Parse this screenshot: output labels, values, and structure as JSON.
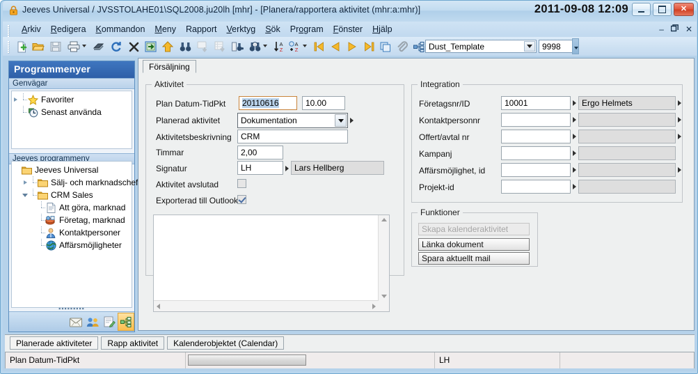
{
  "window": {
    "title": "Jeeves Universal / JVSSTOLAHE01\\SQL2008.ju20lh [mhr]  - [Planera/rapportera aktivitet (mhr:a:mhr)]",
    "clock": "2011-09-08 12:09",
    "lock_icon": "lock-icon",
    "minimize_label": "–",
    "maximize_label": "▭",
    "close_label": "✕",
    "mdi_minimize": "–",
    "mdi_restore": "❐",
    "mdi_close": "✕"
  },
  "menu": {
    "items": [
      {
        "label": "Arkiv",
        "accel": "A"
      },
      {
        "label": "Redigera",
        "accel": "R"
      },
      {
        "label": "Kommandon",
        "accel": "K"
      },
      {
        "label": "Meny",
        "accel": "M"
      },
      {
        "label": "Rapport",
        "accel": ""
      },
      {
        "label": "Verktyg",
        "accel": "V"
      },
      {
        "label": "Sök",
        "accel": "S"
      },
      {
        "label": "Program",
        "accel": "o"
      },
      {
        "label": "Fönster",
        "accel": "F"
      },
      {
        "label": "Hjälp",
        "accel": "H"
      }
    ]
  },
  "toolbar": {
    "template_value": "Dust_Template",
    "number_value": "9998",
    "icons": [
      "new-document-icon",
      "open-folder-icon",
      "save-disk-icon",
      "print-icon",
      "print-dropdown-arrow",
      "erase-icon",
      "refresh-icon",
      "delete-x-icon",
      "open-window-icon",
      "up-arrow-icon",
      "find-binoculars-icon",
      "note-down-icon",
      "grid-down-icon",
      "find-record-icon",
      "find-info-icon",
      "find-dropdown-arrow",
      "sort-az-icon",
      "sort-az-plus-icon",
      "sort-dropdown-arrow",
      "first-record-icon",
      "prev-record-icon",
      "next-record-icon",
      "last-record-icon",
      "copy-icon",
      "attach-clip-icon",
      "hierarchy-icon"
    ]
  },
  "sidebar": {
    "title": "Programmenyer",
    "sections": [
      {
        "header": "Genvägar"
      },
      {
        "header": "Jeeves programmeny"
      }
    ],
    "shortcuts": [
      {
        "label": "Favoriter",
        "icon": "star-icon",
        "expander": "collapsed"
      },
      {
        "label": "Senast använda",
        "icon": "clock-icon",
        "expander": "none"
      }
    ],
    "tree": [
      {
        "label": "Jeeves Universal",
        "icon": "folder-icon",
        "depth": 0,
        "expander": "none"
      },
      {
        "label": "Sälj- och marknadschef",
        "icon": "folder-icon",
        "depth": 1,
        "expander": "collapsed"
      },
      {
        "label": "CRM Sales",
        "icon": "folder-icon",
        "depth": 1,
        "expander": "expanded"
      },
      {
        "label": "Att göra, marknad",
        "icon": "document-icon",
        "depth": 2,
        "expander": "none"
      },
      {
        "label": "Företag, marknad",
        "icon": "company-icon",
        "depth": 2,
        "expander": "none"
      },
      {
        "label": "Kontaktpersoner",
        "icon": "person-icon",
        "depth": 2,
        "expander": "none"
      },
      {
        "label": "Affärsmöjligheter",
        "icon": "globe-icon",
        "depth": 2,
        "expander": "none"
      }
    ],
    "iconbar": [
      "mail-icon",
      "contacts-icon",
      "edit-note-icon",
      "hierarchy-icon"
    ]
  },
  "form": {
    "tab_label": "Försäljning",
    "aktivitet": {
      "title": "Aktivitet",
      "fields": {
        "plan_datum_label": "Plan Datum-TidPkt",
        "plan_datum_value": "20110616",
        "plan_tid_value": "10.00",
        "planerad_aktivitet_label": "Planerad aktivitet",
        "planerad_aktivitet_value": "Dokumentation",
        "aktivitetsbeskrivning_label": "Aktivitetsbeskrivning",
        "aktivitetsbeskrivning_value": "CRM",
        "timmar_label": "Timmar",
        "timmar_value": "2,00",
        "signatur_label": "Signatur",
        "signatur_value": "LH",
        "signatur_name": "Lars Hellberg",
        "avslutad_label": "Aktivitet avslutad",
        "avslutad_checked": false,
        "outlook_label": "Exporterad till Outlook",
        "outlook_checked": true
      },
      "memo_value": ""
    },
    "integration": {
      "title": "Integration",
      "rows": [
        {
          "label": "Företagsnr/ID",
          "value": "10001",
          "desc": "Ergo Helmets",
          "has_desc_arrow": true
        },
        {
          "label": "Kontaktpersonnr",
          "value": "",
          "desc": "",
          "has_desc_arrow": true
        },
        {
          "label": "Offert/avtal nr",
          "value": "",
          "desc": "",
          "has_desc_arrow": true
        },
        {
          "label": "Kampanj",
          "value": "",
          "desc": "",
          "has_desc_arrow": false
        },
        {
          "label": "Affärsmöjlighet, id",
          "value": "",
          "desc": "",
          "has_desc_arrow": true
        },
        {
          "label": "Projekt-id",
          "value": "",
          "desc": "",
          "has_desc_arrow": false
        }
      ]
    },
    "funktioner": {
      "title": "Funktioner",
      "buttons": [
        {
          "label": "Skapa kalenderaktivitet",
          "disabled": true
        },
        {
          "label": "Länka dokument",
          "disabled": false
        },
        {
          "label": "Spara aktuellt mail",
          "disabled": false
        }
      ]
    }
  },
  "bottom_tabs": [
    {
      "label": "Planerade aktiviteter",
      "selected": true
    },
    {
      "label": "Rapp aktivitet",
      "selected": false
    },
    {
      "label": "Kalenderobjektet (Calendar)",
      "selected": false
    }
  ],
  "statusbar": {
    "pane1": "Plan Datum-TidPkt",
    "pane3": "LH",
    "pane4": ""
  },
  "colors": {
    "accent_blue": "#2e5fa8",
    "frame_blue": "#b9d6ee",
    "client_blue": "#b6d2ea",
    "form_grey": "#eef0f0",
    "readonly_grey": "#dedede",
    "close_red": "#cf3f22",
    "active_orange": "#fdbe4e",
    "focus_orange": "#c8833a",
    "selection_blue": "#b9d2ea"
  }
}
